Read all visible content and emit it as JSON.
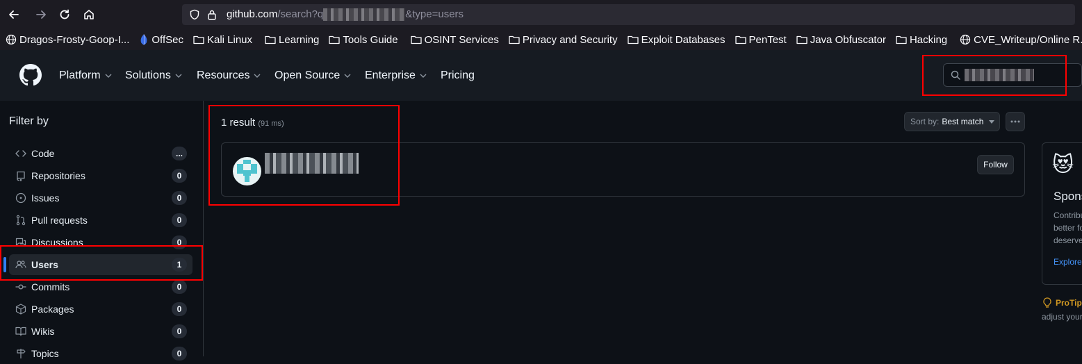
{
  "browser": {
    "url_prefix": "github.com",
    "url_path": "/search?q",
    "url_suffix": "&type=users",
    "bookmarks": [
      {
        "label": "Dragos-Frosty-Goop-I...",
        "icon": "globe-icon"
      },
      {
        "label": "OffSec",
        "icon": "offsec-icon"
      },
      {
        "label": "Kali Linux",
        "icon": "folder-icon"
      },
      {
        "label": "Learning",
        "icon": "folder-icon"
      },
      {
        "label": "Tools Guide",
        "icon": "folder-icon"
      },
      {
        "label": "OSINT Services",
        "icon": "folder-icon"
      },
      {
        "label": "Privacy and Security",
        "icon": "folder-icon"
      },
      {
        "label": "Exploit Databases",
        "icon": "folder-icon"
      },
      {
        "label": "PenTest",
        "icon": "folder-icon"
      },
      {
        "label": "Java Obfuscator",
        "icon": "folder-icon"
      },
      {
        "label": "Hacking",
        "icon": "folder-icon"
      },
      {
        "label": "CVE_Writeup/Online R...",
        "icon": "globe-icon"
      }
    ]
  },
  "header": {
    "nav": [
      {
        "label": "Platform"
      },
      {
        "label": "Solutions"
      },
      {
        "label": "Resources"
      },
      {
        "label": "Open Source"
      },
      {
        "label": "Enterprise"
      },
      {
        "label": "Pricing"
      }
    ]
  },
  "sidebar": {
    "title": "Filter by",
    "items": [
      {
        "label": "Code",
        "count": "...",
        "icon": "code-icon"
      },
      {
        "label": "Repositories",
        "count": "0",
        "icon": "repo-icon"
      },
      {
        "label": "Issues",
        "count": "0",
        "icon": "issue-icon"
      },
      {
        "label": "Pull requests",
        "count": "0",
        "icon": "pull-request-icon"
      },
      {
        "label": "Discussions",
        "count": "0",
        "icon": "discussion-icon"
      },
      {
        "label": "Users",
        "count": "1",
        "icon": "people-icon"
      },
      {
        "label": "Commits",
        "count": "0",
        "icon": "commit-icon"
      },
      {
        "label": "Packages",
        "count": "0",
        "icon": "package-icon"
      },
      {
        "label": "Wikis",
        "count": "0",
        "icon": "book-icon"
      },
      {
        "label": "Topics",
        "count": "0",
        "icon": "signpost-icon"
      }
    ]
  },
  "main": {
    "result_count": "1 result",
    "timing": "(91 ms)",
    "sort_key": "Sort by:",
    "sort_value": "Best match",
    "follow_label": "Follow"
  },
  "sponsor": {
    "title": "Spons",
    "desc1": "Contribu",
    "desc2": "better fo",
    "desc3": "deserve",
    "link": "Explore"
  },
  "protip": {
    "label": "ProTip",
    "text": "adjust your"
  },
  "colors": {
    "accent": "#2f81f7",
    "annotation": "#ff0000",
    "protip": "#d29922"
  }
}
